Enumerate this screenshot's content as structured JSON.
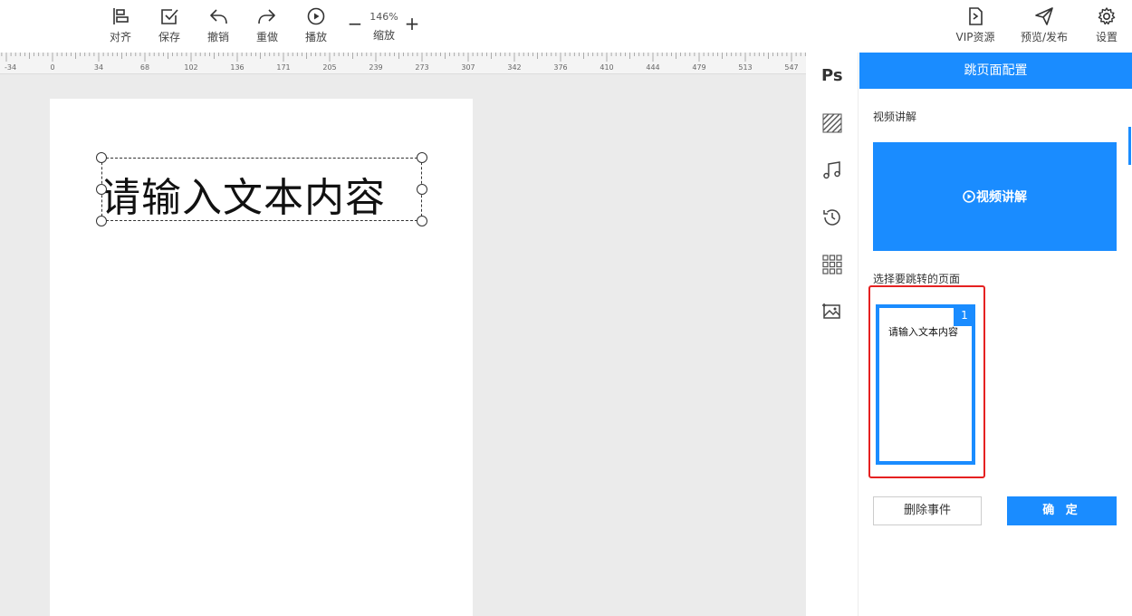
{
  "toolbar": {
    "align_label": "对齐",
    "save_label": "保存",
    "undo_label": "撤销",
    "redo_label": "重做",
    "play_label": "播放",
    "zoom_value": "146%",
    "zoom_label": "缩放",
    "zoom_out": "−",
    "zoom_in": "+",
    "vip_label": "VIP资源",
    "publish_label": "预览/发布",
    "settings_label": "设置"
  },
  "ruler": {
    "ticks": [
      "-34",
      "0",
      "34",
      "68",
      "102",
      "136",
      "171",
      "205",
      "239",
      "273",
      "307",
      "342",
      "376",
      "410",
      "444",
      "479",
      "513",
      "547"
    ]
  },
  "canvas": {
    "text_element": "请输入文本内容"
  },
  "rail": {
    "ps_label": "Ps",
    "icons": [
      "ps-icon",
      "texture-icon",
      "music-icon",
      "history-icon",
      "grid-icon",
      "image-icon"
    ]
  },
  "panel": {
    "title": "跳页面配置",
    "video_section_label": "视频讲解",
    "video_button_label": "视频讲解",
    "pages_section_label": "选择要跳转的页面",
    "pages": [
      {
        "number": "1",
        "preview_text": "请输入文本内容"
      }
    ],
    "delete_label": "删除事件",
    "confirm_label": "确 定"
  },
  "colors": {
    "accent": "#1a8cff",
    "highlight": "#e52121",
    "canvas_bg": "#ebebeb"
  }
}
